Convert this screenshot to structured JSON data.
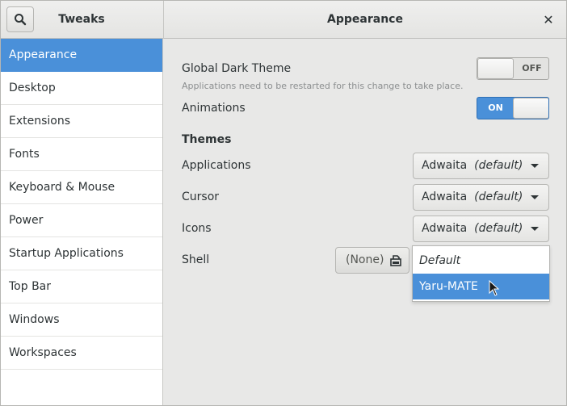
{
  "header": {
    "app_title": "Tweaks",
    "page_title": "Appearance",
    "close_glyph": "✕"
  },
  "sidebar": {
    "items": [
      {
        "label": "Appearance",
        "active": true
      },
      {
        "label": "Desktop"
      },
      {
        "label": "Extensions"
      },
      {
        "label": "Fonts"
      },
      {
        "label": "Keyboard & Mouse"
      },
      {
        "label": "Power"
      },
      {
        "label": "Startup Applications"
      },
      {
        "label": "Top Bar"
      },
      {
        "label": "Windows"
      },
      {
        "label": "Workspaces"
      }
    ]
  },
  "main": {
    "dark_theme": {
      "label": "Global Dark Theme",
      "note": "Applications need to be restarted for this change to take place.",
      "state": "OFF"
    },
    "animations": {
      "label": "Animations",
      "state": "ON"
    },
    "themes_title": "Themes",
    "applications": {
      "label": "Applications",
      "value": "Adwaita",
      "suffix": "(default)"
    },
    "cursor": {
      "label": "Cursor",
      "value": "Adwaita",
      "suffix": "(default)"
    },
    "icons": {
      "label": "Icons",
      "value": "Adwaita",
      "suffix": "(default)"
    },
    "shell": {
      "label": "Shell",
      "value": "(None)"
    },
    "popup": {
      "options": [
        "Default",
        "Yaru-MATE"
      ],
      "highlighted": "Yaru-MATE"
    }
  },
  "colors": {
    "accent": "#4a90d9",
    "sidebar_bg": "#ffffff",
    "window_bg": "#e8e8e7"
  }
}
